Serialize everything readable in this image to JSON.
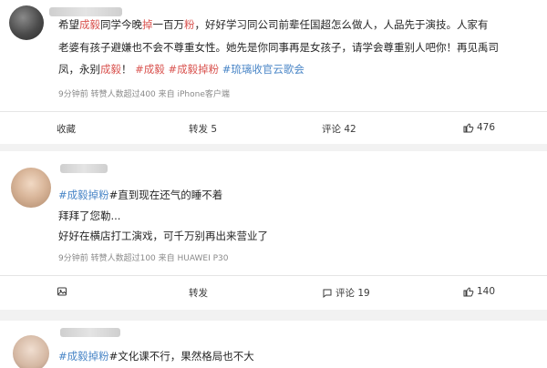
{
  "posts": [
    {
      "text": {
        "line1_a": "希望",
        "line1_b": "成毅",
        "line1_c": "同学今晚",
        "line1_d": "掉",
        "line1_e": "一百万",
        "line1_f": "粉",
        "line1_g": "，好好学习同公司前辈任国超怎么做人，人品先于演技。人家有",
        "line2": "老婆有孩子避嫌也不会不尊重女性。她先是你同事再是女孩子，请学会尊重别人吧你！再见禹司",
        "line3_a": "凤，永别",
        "line3_b": "成毅",
        "line3_c": "！",
        "line3_topic1": "#成毅",
        "line3_topic2": "#成毅掉粉",
        "line3_topic3": "#琉璃收官云歌会"
      },
      "meta": "9分钟前  转赞人数超过400  来自 iPhone客户端",
      "actions": {
        "favorite": "收藏",
        "repost": "转发 5",
        "comment": "评论 42",
        "like": "476"
      }
    },
    {
      "text": {
        "line1_topic": "#成毅掉粉",
        "line1_rest": "#直到现在还气的睡不着",
        "line2": "拜拜了您勒...",
        "line3": "好好在横店打工演戏，可千万别再出来营业了"
      },
      "meta": "9分钟前  转赞人数超过100  来自 HUAWEI P30",
      "actions": {
        "favorite": "收藏",
        "repost": "转发",
        "comment": "评论 19",
        "like": "140"
      }
    },
    {
      "text": {
        "line1_topic": "#成毅掉粉",
        "line1_rest": "#文化课不行，果然格局也不大"
      }
    }
  ],
  "colors": {
    "accent": "#d9534f",
    "topic": "#4a86c7",
    "meta": "#8a8a8a",
    "background": "#f2f2f2"
  }
}
